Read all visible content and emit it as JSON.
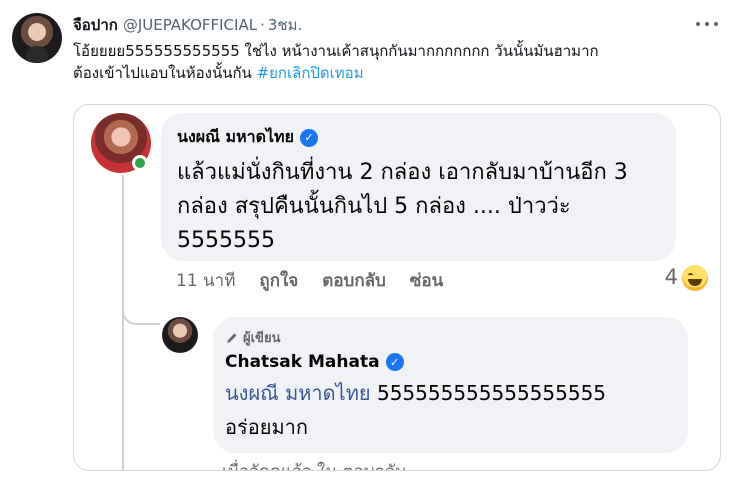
{
  "tweet": {
    "display_name": "จือปาก",
    "handle": "@JUEPAKOFFICIAL",
    "separator": "·",
    "time": "3ชม.",
    "text_line1": "โอ้ยยยย555555555555 ใช่ไง หน้างานเค้าสนุกกันมากกกกกกก วันนั้นมันฮามาก",
    "text_line2_prefix": "ต้องเข้าไปแอบในห้องนั้นกัน ",
    "hashtag": "#ยกเลิกปิดเทอม"
  },
  "comment1": {
    "author": "นงผณี มหาดไทย",
    "verified_mark": "✓",
    "text": "แล้วแม่นั่งกินที่งาน 2 กล่อง เอากลับมาบ้านอีก 3 กล่อง สรุปคืนนั้นกินไป 5 กล่อง .... ป่าวว่ะ 5555555",
    "timestamp": "11 นาที",
    "like_label": "ถูกใจ",
    "reply_label": "ตอบกลับ",
    "hide_label": "ซ่อน",
    "reaction_count": "4"
  },
  "reply1": {
    "badge": "ผู้เขียน",
    "author": "Chatsak Mahata",
    "verified_mark": "✓",
    "mention": "นงผณี มหาดไทย",
    "text_after_mention": " 555555555555555555",
    "text_line2": "อร่อยมาก",
    "cutoff_text": "เมื่อวัดดูแล้ว ใน ตอบกลับ"
  },
  "icons": {
    "more": "more-horizontal-icon",
    "verified": "verified-badge-icon",
    "pen": "pen-icon",
    "reaction": "haha-reaction-icon"
  },
  "colors": {
    "hashtag": "#1d9bf0",
    "fb_verified": "#1877f2",
    "online": "#31a24c",
    "bubble": "#f0f2f5",
    "mention": "#385898"
  }
}
